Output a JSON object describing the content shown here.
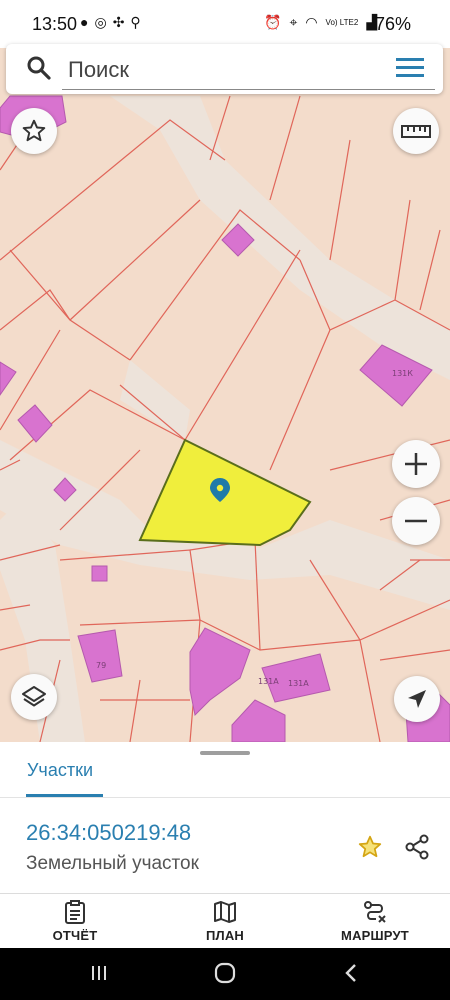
{
  "status_bar": {
    "time": "13:50",
    "battery": "76%",
    "left_icons": [
      "message-icon",
      "whatsapp-icon",
      "fan-icon",
      "search-icon"
    ],
    "right_icons": [
      "alarm-icon",
      "location-icon",
      "wifi-icon",
      "volte-icon",
      "signal-icon"
    ],
    "network_label": "Vo) LTE2"
  },
  "search": {
    "placeholder": "Поиск",
    "value": ""
  },
  "map": {
    "building_labels": [
      "131К",
      "131А",
      "131А",
      "79"
    ],
    "selected_parcel_color": "#f0ee3c",
    "parcel_line_color": "#e0665a",
    "building_color": "#d873cf",
    "road_color": "#efe5dc"
  },
  "sheet": {
    "tab_label": "Участки",
    "parcel_number": "26:34:050219:48",
    "parcel_type": "Земельный участок"
  },
  "actions": [
    {
      "label": "ОТЧЁТ",
      "icon": "report-icon"
    },
    {
      "label": "ПЛАН",
      "icon": "map-plan-icon"
    },
    {
      "label": "МАРШРУТ",
      "icon": "route-icon"
    }
  ],
  "colors": {
    "accent": "#2a7fb0",
    "favorite_star": "#e8b820"
  }
}
